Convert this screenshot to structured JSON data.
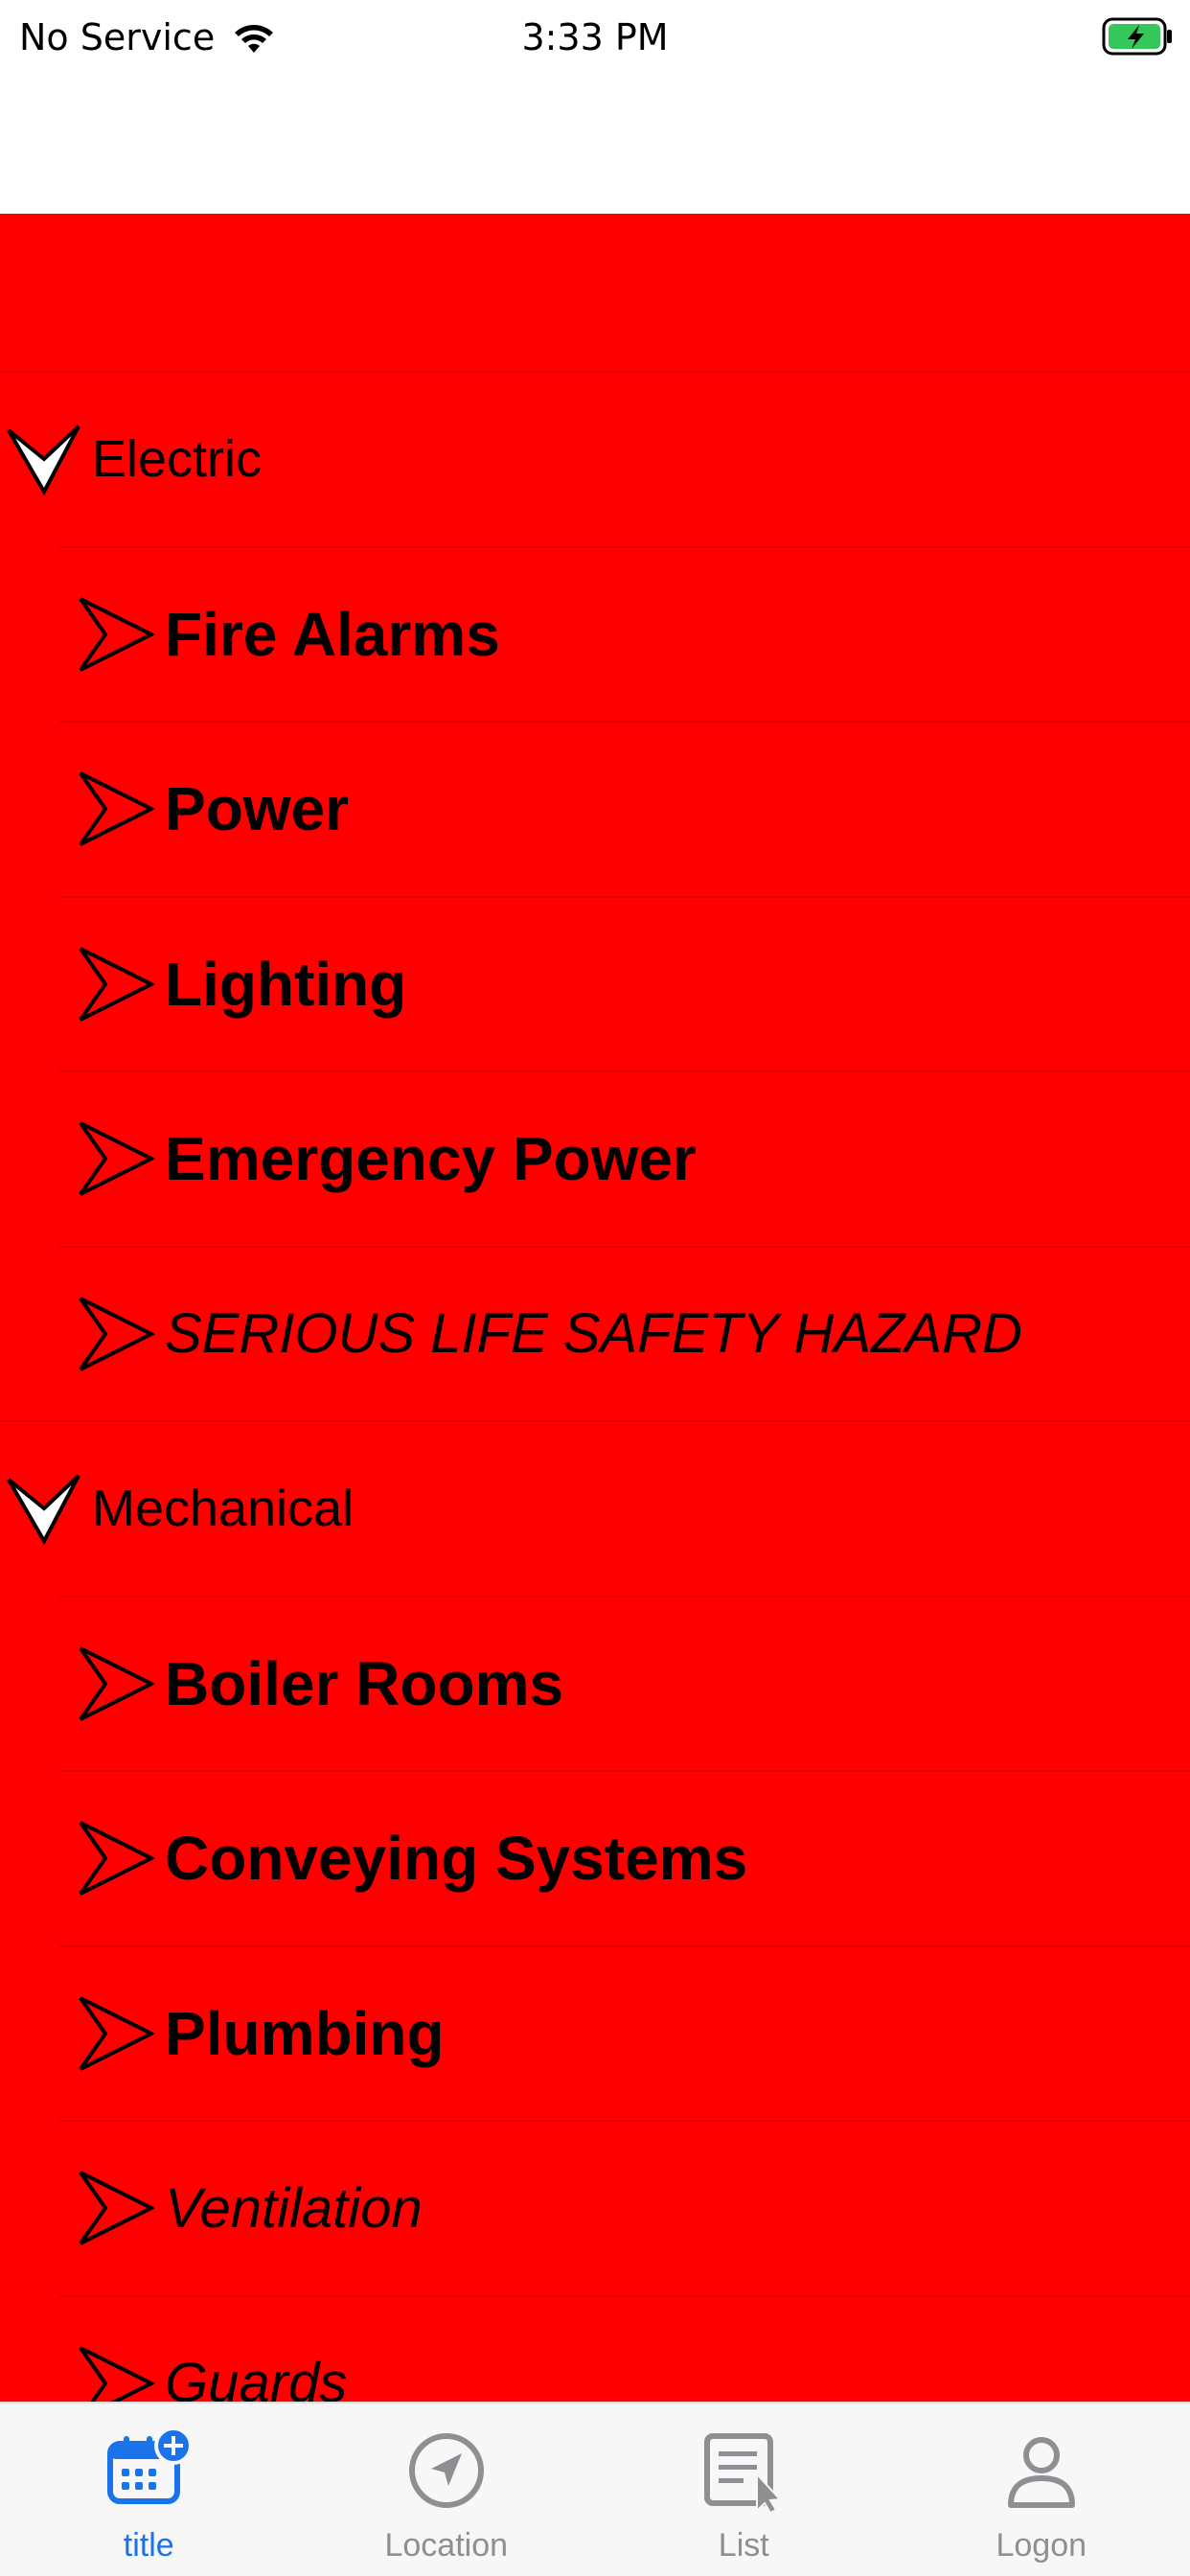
{
  "status_bar": {
    "carrier": "No Service",
    "time": "3:33 PM"
  },
  "sections": [
    {
      "title": "Electric",
      "items": [
        {
          "label": "Fire Alarms",
          "style": "bold"
        },
        {
          "label": "Power",
          "style": "bold"
        },
        {
          "label": "Lighting",
          "style": "bold"
        },
        {
          "label": "Emergency Power",
          "style": "bold"
        },
        {
          "label": "SERIOUS LIFE SAFETY HAZARD",
          "style": "italic"
        }
      ]
    },
    {
      "title": "Mechanical",
      "items": [
        {
          "label": "Boiler Rooms",
          "style": "bold"
        },
        {
          "label": "Conveying Systems",
          "style": "bold"
        },
        {
          "label": "Plumbing",
          "style": "bold"
        },
        {
          "label": "Ventilation",
          "style": "italic"
        },
        {
          "label": "Guards",
          "style": "italic"
        }
      ]
    }
  ],
  "tab_bar": {
    "tabs": [
      {
        "label": "title",
        "icon": "calendar-add-icon",
        "active": true
      },
      {
        "label": "Location",
        "icon": "location-arrow-icon",
        "active": false
      },
      {
        "label": "List",
        "icon": "list-pointer-icon",
        "active": false
      },
      {
        "label": "Logon",
        "icon": "person-icon",
        "active": false
      }
    ]
  },
  "colors": {
    "list_background": "#ff0000",
    "tab_active": "#1a73e8",
    "tab_inactive": "#8e8e93",
    "status_battery_fill": "#34c759"
  }
}
